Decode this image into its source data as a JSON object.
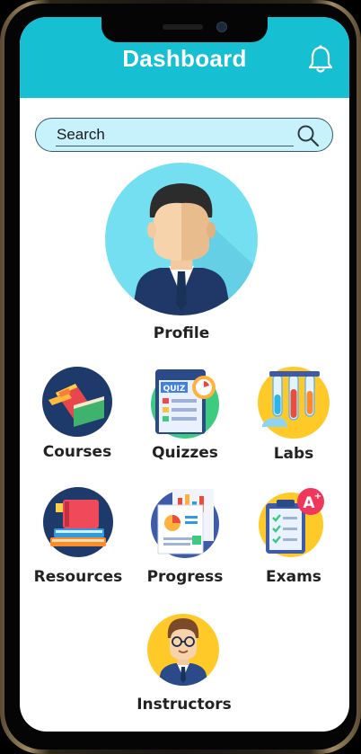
{
  "header": {
    "title": "Dashboard",
    "notification_icon": "bell-icon"
  },
  "search": {
    "placeholder": "Search",
    "value": ""
  },
  "profile": {
    "label": "Profile"
  },
  "menu": [
    {
      "label": "Courses",
      "icon": "books-icon"
    },
    {
      "label": "Quizzes",
      "icon": "quiz-icon"
    },
    {
      "label": "Labs",
      "icon": "test-tubes-icon"
    },
    {
      "label": "Resources",
      "icon": "stacked-books-icon"
    },
    {
      "label": "Progress",
      "icon": "report-chart-icon"
    },
    {
      "label": "Exams",
      "icon": "exam-clipboard-icon"
    },
    {
      "label": "Instructors",
      "icon": "teacher-avatar-icon"
    }
  ],
  "colors": {
    "header": "#17bfd2",
    "search_bg": "#c8f2fb",
    "profile_circle": "#74dff0"
  }
}
